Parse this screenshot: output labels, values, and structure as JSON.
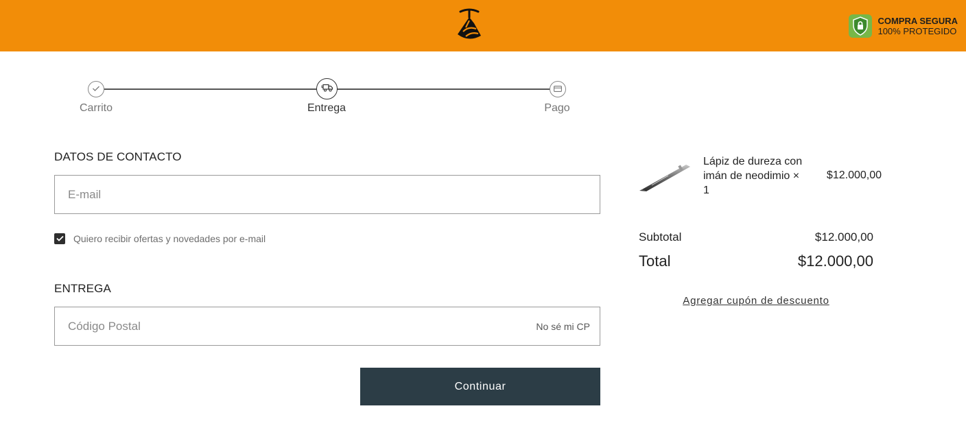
{
  "header": {
    "logo_icon": "pickaxe-logo-icon",
    "secure_icon": "lock-shield-icon",
    "secure_title": "COMPRA SEGURA",
    "secure_subtitle": "100% PROTEGIDO"
  },
  "steps": [
    {
      "label": "Carrito",
      "icon": "check-icon",
      "state": "done"
    },
    {
      "label": "Entrega",
      "icon": "delivery-truck-icon",
      "state": "active"
    },
    {
      "label": "Pago",
      "icon": "credit-card-icon",
      "state": "pending"
    }
  ],
  "contact": {
    "title": "DATOS DE CONTACTO",
    "email_placeholder": "E-mail",
    "email_value": "",
    "newsletter_checked": true,
    "newsletter_label": "Quiero recibir ofertas y novedades por e-mail"
  },
  "delivery": {
    "title": "ENTREGA",
    "postal_placeholder": "Código Postal",
    "postal_value": "",
    "unknown_cp_link": "No sé mi CP"
  },
  "continue_label": "Continuar",
  "summary": {
    "product": {
      "name": "Lápiz de dureza con imán de neodimio × 1",
      "price": "$12.000,00",
      "image_icon": "hardness-pen-image"
    },
    "subtotal_label": "Subtotal",
    "subtotal_value": "$12.000,00",
    "total_label": "Total",
    "total_value": "$12.000,00",
    "coupon_link": "Agregar cupón de descuento"
  },
  "colors": {
    "header_bg": "#f28d08",
    "button_bg": "#2c3d46",
    "secure_green": "#77b748"
  }
}
